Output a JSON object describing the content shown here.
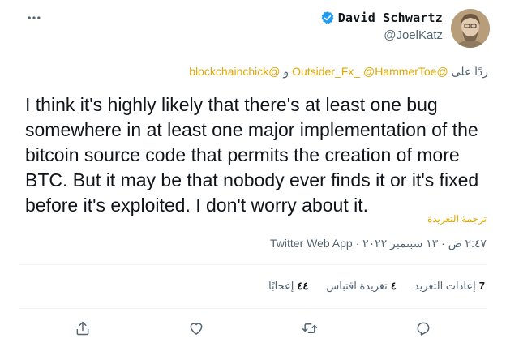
{
  "author": {
    "display_name": "David Schwartz",
    "handle": "@JoelKatz",
    "verified": true
  },
  "reply": {
    "prefix": "ردًا على",
    "mentions_part1": "@Outsider_Fx_ @HammerToe",
    "conjunction": "و",
    "mentions_part2": "@blockchainchick"
  },
  "tweet": {
    "text": "I think it's highly likely that there's at least one bug somewhere in at least one major implementation of the bitcoin source code that permits the creation of more BTC. But it may be that nobody ever finds it or it's fixed before it's exploited. I don't worry about it.",
    "translate_label": "ترجمة التغريدة"
  },
  "meta": {
    "text": "٢:٤٧ ص · ١٣ سبتمبر ٢٠٢٢ · Twitter Web App"
  },
  "stats": {
    "retweets_count": "7",
    "retweets_label": "إعادات التغريد",
    "quotes_count": "٤",
    "quotes_label": "تغريدة اقتباس",
    "likes_count": "٤٤",
    "likes_label": "إعجابًا"
  },
  "icons": {
    "more": "more-horizontal-icon",
    "verified": "verified-badge-icon",
    "reply": "reply-icon",
    "retweet": "retweet-icon",
    "like": "heart-icon",
    "share": "share-icon"
  },
  "colors": {
    "accent": "#e0a800",
    "verified": "#1d9bf0",
    "text": "#0f1419",
    "secondary": "#536471"
  }
}
